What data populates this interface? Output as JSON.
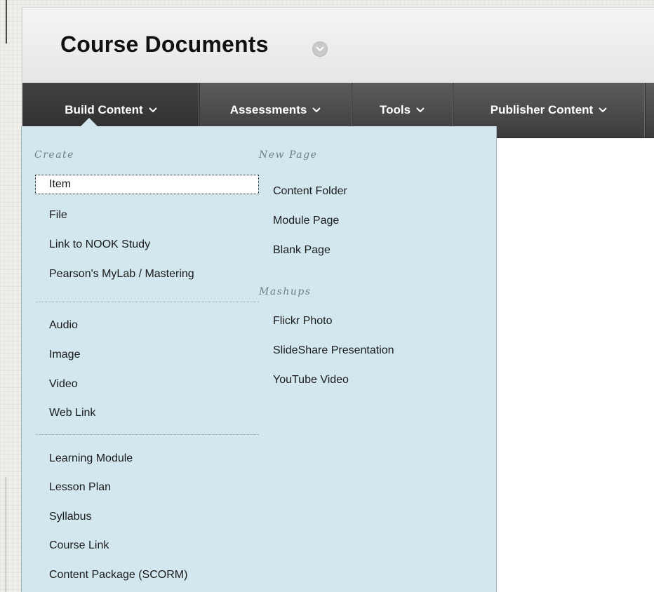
{
  "page": {
    "title": "Course Documents",
    "title_menu_icon": "chevron-down-icon"
  },
  "nav": {
    "tabs": [
      {
        "label": "Build Content",
        "icon": "chevron-down-icon",
        "active": true
      },
      {
        "label": "Assessments",
        "icon": "chevron-down-icon",
        "active": false
      },
      {
        "label": "Tools",
        "icon": "chevron-down-icon",
        "active": false
      },
      {
        "label": "Publisher Content",
        "icon": "chevron-down-icon",
        "active": false
      }
    ]
  },
  "menu": {
    "create": {
      "header": "Create",
      "group1": [
        "Item",
        "File",
        "Link to NOOK Study",
        "Pearson's MyLab / Mastering"
      ],
      "group2": [
        "Audio",
        "Image",
        "Video",
        "Web Link"
      ],
      "group3": [
        "Learning Module",
        "Lesson Plan",
        "Syllabus",
        "Course Link",
        "Content Package (SCORM)"
      ]
    },
    "new_page": {
      "header": "New Page",
      "items": [
        "Content Folder",
        "Module Page",
        "Blank Page"
      ]
    },
    "mashups": {
      "header": "Mashups",
      "items": [
        "Flickr Photo",
        "SlideShare Presentation",
        "YouTube Video"
      ]
    },
    "selected_item": "Item"
  },
  "colors": {
    "menu_background": "#d2e8ee",
    "nav_background": "#4a4a4a",
    "header_background": "#ececec",
    "section_header": "#6d8186"
  }
}
